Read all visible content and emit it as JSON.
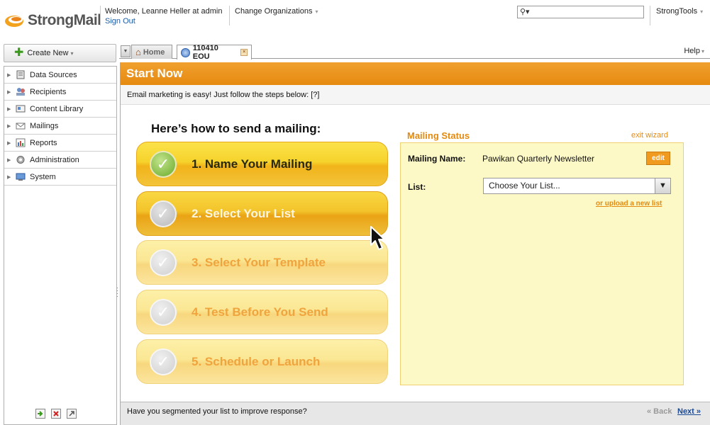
{
  "brand": {
    "name": "StrongMail"
  },
  "header": {
    "welcome": "Welcome, Leanne Heller at admin",
    "sign_out": "Sign Out",
    "change_org": "Change Organizations",
    "search_placeholder": "",
    "strongtools": "StrongTools"
  },
  "sidebar": {
    "create_new": "Create New",
    "items": [
      {
        "label": "Data Sources",
        "icon": "data-sources-icon"
      },
      {
        "label": "Recipients",
        "icon": "recipients-icon"
      },
      {
        "label": "Content Library",
        "icon": "content-library-icon"
      },
      {
        "label": "Mailings",
        "icon": "mailings-icon"
      },
      {
        "label": "Reports",
        "icon": "reports-icon"
      },
      {
        "label": "Administration",
        "icon": "administration-icon"
      },
      {
        "label": "System",
        "icon": "system-icon"
      }
    ]
  },
  "tabs": {
    "home": "Home",
    "active": "110410 EOU",
    "help": "Help"
  },
  "wizard": {
    "title": "Start Now",
    "subtitle": "Email marketing is easy! Just follow the steps below: [?]",
    "howto": "Here’s how to send a mailing:",
    "steps": [
      {
        "label": "1. Name Your Mailing",
        "state": "done"
      },
      {
        "label": "2. Select Your List",
        "state": "current"
      },
      {
        "label": "3. Select Your Template",
        "state": "todo"
      },
      {
        "label": "4. Test Before You Send",
        "state": "todo"
      },
      {
        "label": "5. Schedule or Launch",
        "state": "todo"
      }
    ]
  },
  "status": {
    "title": "Mailing Status",
    "exit": "exit wizard",
    "mailing_name_label": "Mailing Name:",
    "mailing_name_value": "Pawikan Quarterly Newsletter",
    "edit": "edit",
    "list_label": "List:",
    "list_select": "Choose Your List...",
    "upload_link": "or upload a new list"
  },
  "footer": {
    "question": "Have you segmented your list to improve response?",
    "back": "« Back",
    "next": "Next »"
  },
  "colors": {
    "accent": "#e68a10",
    "panel": "#fdf9c6",
    "link": "#1b4a96"
  }
}
